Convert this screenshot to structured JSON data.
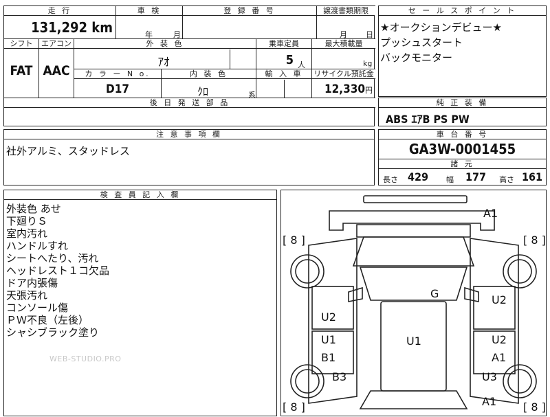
{
  "top_table": {
    "mileage_label": "走 行",
    "mileage_value": "131,292",
    "mileage_unit": "km",
    "inspection_label": "車 検",
    "inspection_year": "年",
    "inspection_month": "月",
    "registration_label": "登 録 番 号",
    "transfer_label": "譲渡書類期限",
    "transfer_month": "月",
    "transfer_day": "日",
    "shift_label": "シフト",
    "shift_value": "FAT",
    "ac_label": "エアコン",
    "ac_value": "AAC",
    "exterior_label": "外 装 色",
    "exterior_value": "ｱｵ",
    "capacity_label": "乗車定員",
    "capacity_value": "5",
    "capacity_unit": "人",
    "load_label": "最大積載量",
    "load_unit": "kg",
    "color_no_label": "カ ラ ー N o.",
    "color_no_value": "D17",
    "interior_label": "内 装 色",
    "interior_value": "ｸﾛ",
    "interior_suffix": "系",
    "import_label": "輸 入 車",
    "recycle_label": "リサイクル預託金",
    "recycle_value": "12,330",
    "recycle_unit": "円",
    "later_parts_label": "後 日 発 送 部 品"
  },
  "sales_points": {
    "header": "セ ー ル ス ポ イ ン ト",
    "items": [
      "★オークションデビュー★",
      "プッシュスタート",
      "バックモニター"
    ]
  },
  "genuine_equipment": {
    "header": "純 正 装 備",
    "value": "ABS ｴｱB PS PW"
  },
  "caution": {
    "header": "注 意 事 項 欄",
    "text": "社外アルミ、スタッドレス"
  },
  "chassis": {
    "header": "車 台 番 号",
    "value": "GA3W-0001455",
    "spec_header": "諸 元",
    "length_label": "長さ",
    "length_value": "429",
    "width_label": "幅",
    "width_value": "177",
    "height_label": "高さ",
    "height_value": "161"
  },
  "inspector": {
    "header": "検 査 員 記 入 欄",
    "notes": [
      "外装色 あせ",
      "下廻りＳ",
      "室内汚れ",
      "ハンドルすれ",
      "シートへたり、汚れ",
      "ヘッドレスト１コ欠品",
      "ドア内張傷",
      "天張汚れ",
      "コンソール傷",
      "ＰＷ不良（左後）",
      "シャシブラック塗り"
    ],
    "watermark": "WEB-STUDIO.PRO"
  },
  "car_diagram": {
    "tire_labels": [
      "[ 8 ]",
      "[ 8 ]",
      "[ 8 ]",
      "[ 8 ]"
    ],
    "marks": {
      "front_bumper": "A1",
      "windshield": "G",
      "left_front_door": "U2",
      "right_front_door": "U2",
      "left_rear_door_top": "U1",
      "left_rear_door_bottom": "B1",
      "roof": "U1",
      "right_rear_door_top": "U2",
      "right_rear_door_bottom": "A1",
      "left_quarter": "B3",
      "right_quarter": "U3",
      "rear_bumper": "A1"
    }
  }
}
